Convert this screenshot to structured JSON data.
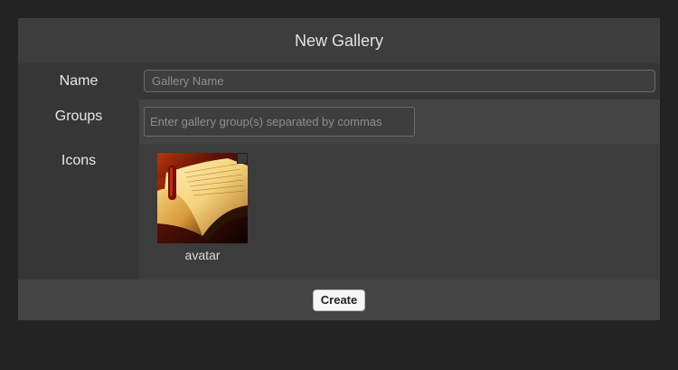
{
  "dialog": {
    "title": "New Gallery",
    "name": {
      "label": "Name",
      "value": "",
      "placeholder": "Gallery Name"
    },
    "groups": {
      "label": "Groups",
      "value": "",
      "placeholder": "Enter gallery group(s) separated by commas"
    },
    "icons": {
      "label": "Icons",
      "items": [
        {
          "caption": "avatar",
          "image": "open-book-photo",
          "selected": false
        }
      ]
    },
    "create_label": "Create"
  }
}
